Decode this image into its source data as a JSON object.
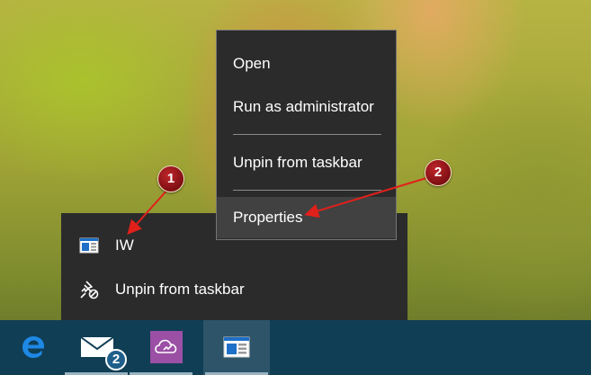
{
  "jump_list": {
    "items": [
      {
        "label": "IW",
        "icon": "app-window-icon"
      },
      {
        "label": "Unpin from taskbar",
        "icon": "unpin-icon"
      }
    ]
  },
  "context_menu": {
    "items": [
      {
        "label": "Open"
      },
      {
        "label": "Run as administrator"
      },
      {
        "label": "Unpin from taskbar"
      },
      {
        "label": "Properties",
        "highlighted": true
      }
    ]
  },
  "callouts": [
    {
      "label": "1"
    },
    {
      "label": "2"
    }
  ],
  "taskbar": {
    "items": [
      {
        "name": "Edge",
        "icon": "edge-icon"
      },
      {
        "name": "Mail",
        "icon": "mail-icon",
        "badge": "2"
      },
      {
        "name": "OneDrive app",
        "icon": "cloud-icon"
      },
      {
        "name": "IW",
        "icon": "app-window-icon",
        "active": true
      }
    ]
  },
  "colors": {
    "menu_bg": "#2b2b2b",
    "menu_highlight": "#414141",
    "taskbar_bg": "#103e55",
    "callout": "#b3181d",
    "arrow": "#e0201b"
  }
}
